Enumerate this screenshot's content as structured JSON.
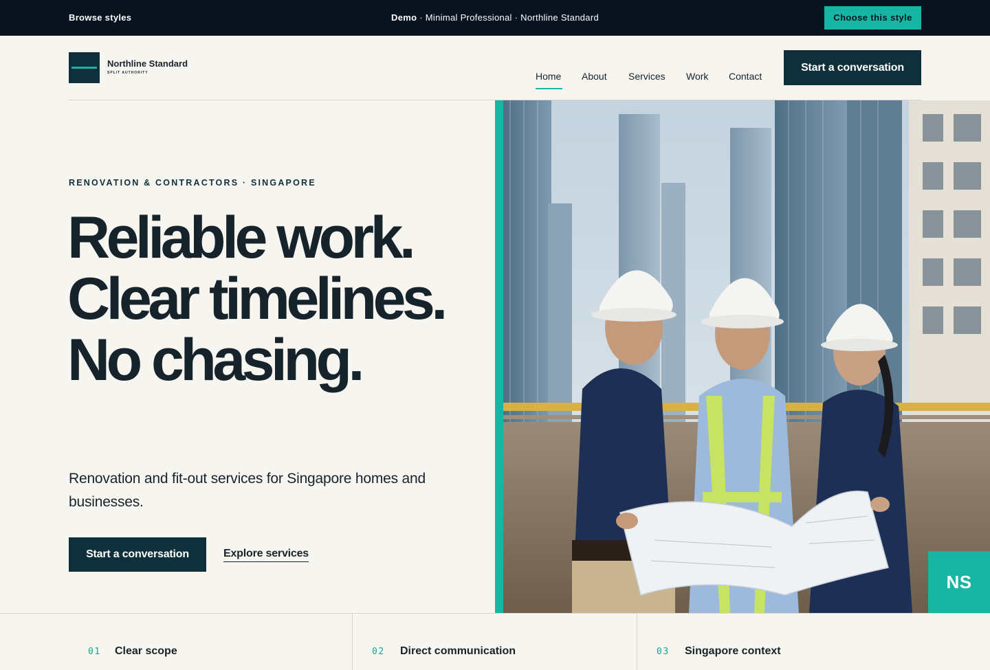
{
  "demo_bar": {
    "browse_label": "Browse styles",
    "demo_label": "Demo",
    "center_text": " · Minimal Professional · Northline Standard",
    "choose_label": "Choose this style"
  },
  "brand": {
    "name": "Northline Standard",
    "tagline": "SPLIT AUTHORITY"
  },
  "nav": {
    "items": [
      {
        "label": "Home",
        "active": true
      },
      {
        "label": "About"
      },
      {
        "label": "Services"
      },
      {
        "label": "Work"
      },
      {
        "label": "Contact"
      }
    ],
    "cta_label": "Start a conversation"
  },
  "hero": {
    "eyebrow": "RENOVATION & CONTRACTORS · SINGAPORE",
    "headline": "Reliable work. Clear timelines. No chasing.",
    "subcopy": "Renovation and fit-out services for Singapore homes and businesses.",
    "primary_cta": "Start a conversation",
    "secondary_cta": "Explore services",
    "badge": "NS"
  },
  "features": [
    {
      "num": "01",
      "label": "Clear scope"
    },
    {
      "num": "02",
      "label": "Direct communication"
    },
    {
      "num": "03",
      "label": "Singapore context"
    }
  ],
  "colors": {
    "accent": "#17b5a4",
    "primary": "#0f2f3a",
    "background": "#f7f5f0",
    "dark_bar": "#08131f"
  }
}
